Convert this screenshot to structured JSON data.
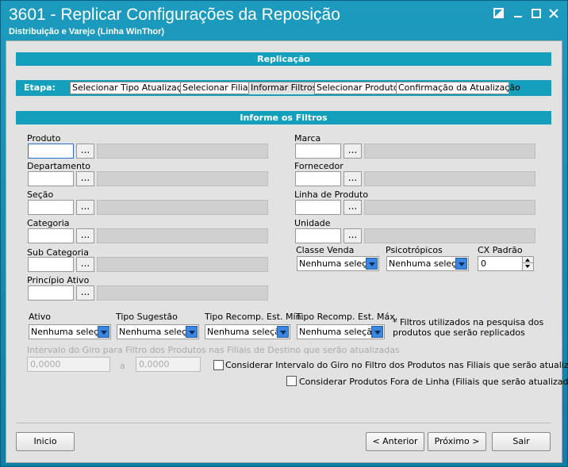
{
  "window": {
    "title": "3601 - Replicar Configurações da Reposição",
    "subtitle": "Distribuição e Varejo (Linha WinThor)"
  },
  "replicacao": {
    "header": "Replicação"
  },
  "etapa": {
    "label": "Etapa:",
    "tabs": [
      "Selecionar Tipo Atualização",
      "Selecionar Filiais",
      "Informar Filtros",
      "Selecionar Produtos",
      "Confirmação da Atualização"
    ],
    "active": "Informar Filtros"
  },
  "filtros": {
    "header": "Informe os Filtros",
    "left": [
      {
        "label": "Produto",
        "value": ""
      },
      {
        "label": "Departamento",
        "value": ""
      },
      {
        "label": "Seção",
        "value": ""
      },
      {
        "label": "Categoria",
        "value": ""
      },
      {
        "label": "Sub Categoria",
        "value": ""
      },
      {
        "label": "Princípio Ativo",
        "value": ""
      }
    ],
    "right": [
      {
        "label": "Marca",
        "value": ""
      },
      {
        "label": "Fornecedor",
        "value": ""
      },
      {
        "label": "Linha de Produto",
        "value": ""
      },
      {
        "label": "Unidade",
        "value": ""
      }
    ],
    "lookup_button": "...",
    "classe_venda": {
      "label": "Classe Venda",
      "value": "Nenhuma seleção"
    },
    "psicotropicos": {
      "label": "Psicotrópicos",
      "value": "Nenhuma seleção"
    },
    "cx_padrao": {
      "label": "CX Padrão",
      "value": "0"
    },
    "ativo": {
      "label": "Ativo",
      "value": "Nenhuma seleção"
    },
    "tipo_sugestao": {
      "label": "Tipo Sugestão",
      "value": "Nenhuma seleção"
    },
    "tipo_recomp_min": {
      "label": "Tipo Recomp. Est. Mín.",
      "value": "Nenhuma seleção"
    },
    "tipo_recomp_max": {
      "label": "Tipo Recomp. Est. Máx.",
      "value": "Nenhuma seleção"
    },
    "note_line1": "* Filtros utilizados na pesquisa dos",
    "note_line2": "produtos que serão replicados",
    "intervalo_label": "Intervalo do Giro para Filtro dos Produtos nas Filiais de Destino que serão atualizadas",
    "intervalo_from": "0,0000",
    "intervalo_sep": "a",
    "intervalo_to": "0,0000",
    "chk_intervalo": {
      "label": "Considerar Intervalo do Giro no Filtro dos Produtos nas Filiais que serão atualizadas",
      "checked": false
    },
    "chk_fora_linha": {
      "label": "Considerar Produtos Fora de Linha (Filiais que serão atualizadas)",
      "checked": false
    }
  },
  "buttons": {
    "inicio": "Inicio",
    "anterior": "< Anterior",
    "proximo": "Próximo >",
    "sair": "Sair"
  }
}
